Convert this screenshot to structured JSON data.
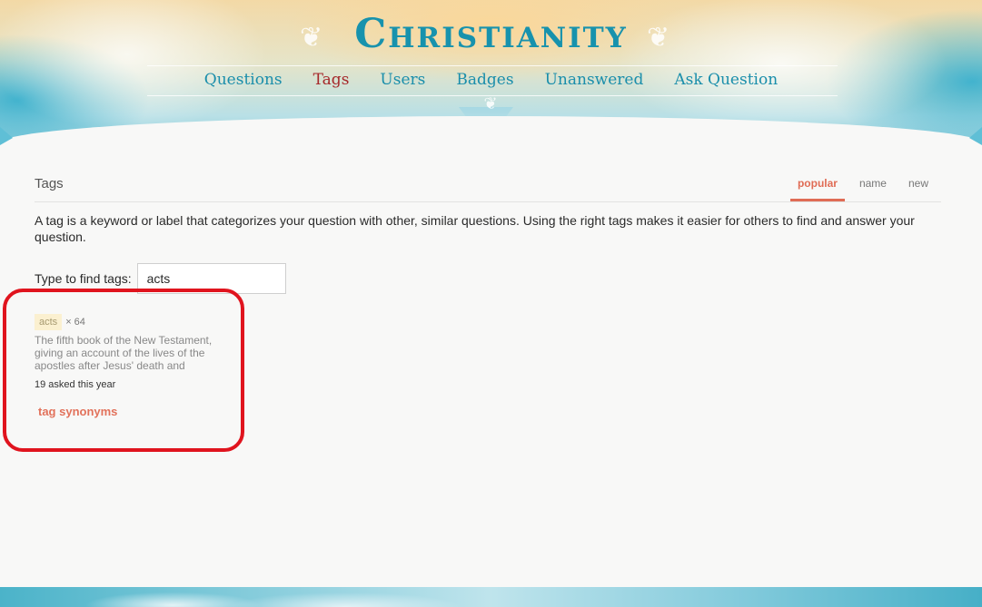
{
  "site": {
    "logo_text": "Christianity",
    "flourish_glyph": "❦"
  },
  "nav": {
    "items": [
      {
        "label": "Questions",
        "active": false
      },
      {
        "label": "Tags",
        "active": true
      },
      {
        "label": "Users",
        "active": false
      },
      {
        "label": "Badges",
        "active": false
      },
      {
        "label": "Unanswered",
        "active": false
      },
      {
        "label": "Ask Question",
        "active": false
      }
    ]
  },
  "page": {
    "title": "Tags",
    "tabs": [
      {
        "label": "popular",
        "active": true
      },
      {
        "label": "name",
        "active": false
      },
      {
        "label": "new",
        "active": false
      }
    ],
    "description": "A tag is a keyword or label that categorizes your question with other, similar questions. Using the right tags makes it easier for others to find and answer your question.",
    "finder": {
      "label": "Type to find tags:",
      "value": "acts"
    }
  },
  "tag_result": {
    "name": "acts",
    "multiplier": "× 64",
    "excerpt": "The fifth book of the New Testament, giving an account of the lives of the apostles after Jesus' death and",
    "stats": "19 asked this year",
    "synonyms_link": "tag synonyms"
  },
  "colors": {
    "brand": "#1792ad",
    "nav_active": "#a6282a",
    "accent": "#e06c55",
    "highlight_box": "#e0141e",
    "tag_bg": "#fbf0d0"
  }
}
